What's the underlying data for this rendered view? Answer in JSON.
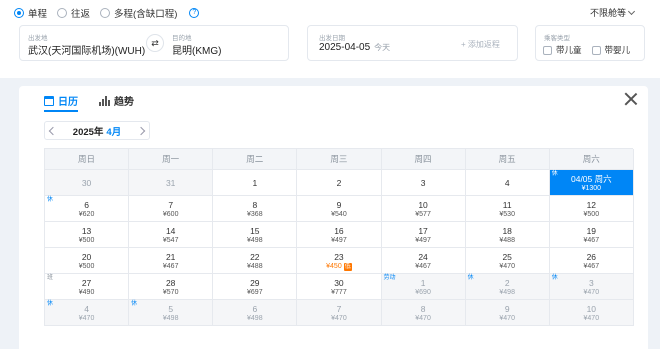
{
  "trip_types": [
    {
      "label": "单程",
      "checked": true
    },
    {
      "label": "往返",
      "checked": false
    },
    {
      "label": "多程(含缺口程)",
      "checked": false
    }
  ],
  "cabin": {
    "label": "不限舱等"
  },
  "route": {
    "from_label": "出发地",
    "from_value": "武汉(天河国际机场)(WUH)",
    "swap_icon": "⇄",
    "to_label": "目的地",
    "to_value": "昆明(KMG)"
  },
  "date": {
    "label": "出发日期",
    "value": "2025-04-05",
    "relative": "今天",
    "add_leg": "+ 添加返程"
  },
  "passengers": {
    "label": "乘客类型",
    "options": [
      "带儿童",
      "带婴儿"
    ]
  },
  "calendar": {
    "tabs": [
      {
        "label": "日历",
        "active": true
      },
      {
        "label": "趋势",
        "active": false
      }
    ],
    "year": "2025年",
    "month": "4月",
    "weekdays": [
      "周日",
      "周一",
      "周二",
      "周三",
      "周四",
      "周五",
      "周六"
    ],
    "cells": [
      {
        "day": "30",
        "price": "",
        "muted": true
      },
      {
        "day": "31",
        "price": "",
        "muted": true
      },
      {
        "day": "1",
        "price": ""
      },
      {
        "day": "2",
        "price": ""
      },
      {
        "day": "3",
        "price": ""
      },
      {
        "day": "4",
        "price": ""
      },
      {
        "day": "04/05 周六",
        "price": "¥1300",
        "tag": "休",
        "selected": true
      },
      {
        "day": "6",
        "price": "¥620",
        "tag": "休"
      },
      {
        "day": "7",
        "price": "¥600"
      },
      {
        "day": "8",
        "price": "¥368"
      },
      {
        "day": "9",
        "price": "¥540"
      },
      {
        "day": "10",
        "price": "¥577"
      },
      {
        "day": "11",
        "price": "¥530"
      },
      {
        "day": "12",
        "price": "¥500"
      },
      {
        "day": "13",
        "price": "¥500"
      },
      {
        "day": "14",
        "price": "¥547"
      },
      {
        "day": "15",
        "price": "¥498"
      },
      {
        "day": "16",
        "price": "¥497"
      },
      {
        "day": "17",
        "price": "¥497"
      },
      {
        "day": "18",
        "price": "¥488"
      },
      {
        "day": "19",
        "price": "¥467"
      },
      {
        "day": "20",
        "price": "¥500"
      },
      {
        "day": "21",
        "price": "¥467"
      },
      {
        "day": "22",
        "price": "¥488"
      },
      {
        "day": "23",
        "price": "¥450",
        "low": "低"
      },
      {
        "day": "24",
        "price": "¥467"
      },
      {
        "day": "25",
        "price": "¥470"
      },
      {
        "day": "26",
        "price": "¥467"
      },
      {
        "day": "27",
        "price": "¥490",
        "tag": "班",
        "tag_type": "work"
      },
      {
        "day": "28",
        "price": "¥570"
      },
      {
        "day": "29",
        "price": "¥697"
      },
      {
        "day": "30",
        "price": "¥777"
      },
      {
        "day": "1",
        "price": "¥690",
        "tag": "劳动",
        "muted": true
      },
      {
        "day": "2",
        "price": "¥498",
        "tag": "休",
        "muted": true
      },
      {
        "day": "3",
        "price": "¥470",
        "tag": "休",
        "muted": true
      },
      {
        "day": "4",
        "price": "¥470",
        "tag": "休",
        "muted": true
      },
      {
        "day": "5",
        "price": "¥498",
        "tag": "休",
        "muted": true
      },
      {
        "day": "6",
        "price": "¥498",
        "muted": true
      },
      {
        "day": "7",
        "price": "¥470",
        "muted": true
      },
      {
        "day": "8",
        "price": "¥470",
        "muted": true
      },
      {
        "day": "9",
        "price": "¥470",
        "muted": true
      },
      {
        "day": "10",
        "price": "¥470",
        "muted": true
      }
    ]
  },
  "colors": {
    "accent": "#0086f6",
    "low_price": "#ff7700"
  }
}
